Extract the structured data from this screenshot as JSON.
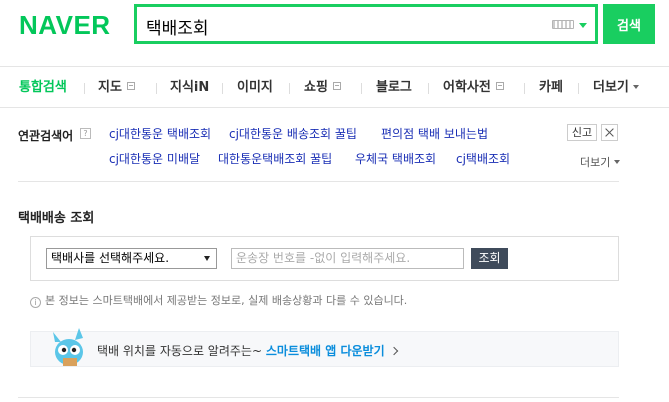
{
  "header": {
    "logo": "NAVER",
    "search_value": "택배조회",
    "search_button": "검색"
  },
  "tabs": [
    {
      "label": "통합검색",
      "active": true
    },
    {
      "label": "지도",
      "has_icon": true
    },
    {
      "label": "지식iN"
    },
    {
      "label": "이미지"
    },
    {
      "label": "쇼핑",
      "has_icon": true
    },
    {
      "label": "블로그"
    },
    {
      "label": "어학사전",
      "has_icon": true
    },
    {
      "label": "카페"
    },
    {
      "label": "더보기",
      "has_caret": true
    }
  ],
  "related": {
    "title": "연관검색어",
    "help": "?",
    "report": "신고",
    "more": "더보기",
    "row1": [
      "cj대한통운 택배조회",
      "cj대한통운 배송조회 꿀팁",
      "편의점 택배 보내는법"
    ],
    "row2": [
      "cj대한통운 미배달",
      "대한통운택배조회 꿀팁",
      "우체국 택배조회",
      "cj택배조회"
    ]
  },
  "delivery": {
    "title": "택배배송 조회",
    "carrier_select": "택배사를 선택해주세요.",
    "tracking_placeholder": "운송장 번호를 -없이 입력해주세요.",
    "lookup_button": "조회",
    "info": "본 정보는 스마트택배에서 제공받는 정보로, 실제 배송상황과 다를 수 있습니다.",
    "banner_text": "택배 위치를 자동으로 알려주는~",
    "banner_link": "스마트택배 앱 다운받기"
  },
  "colors": {
    "brand": "#03c75a",
    "search_border": "#19ce60",
    "link": "#1a2fb5",
    "banner_link": "#0a8ddc",
    "lookup_button": "#3f4b5b"
  }
}
